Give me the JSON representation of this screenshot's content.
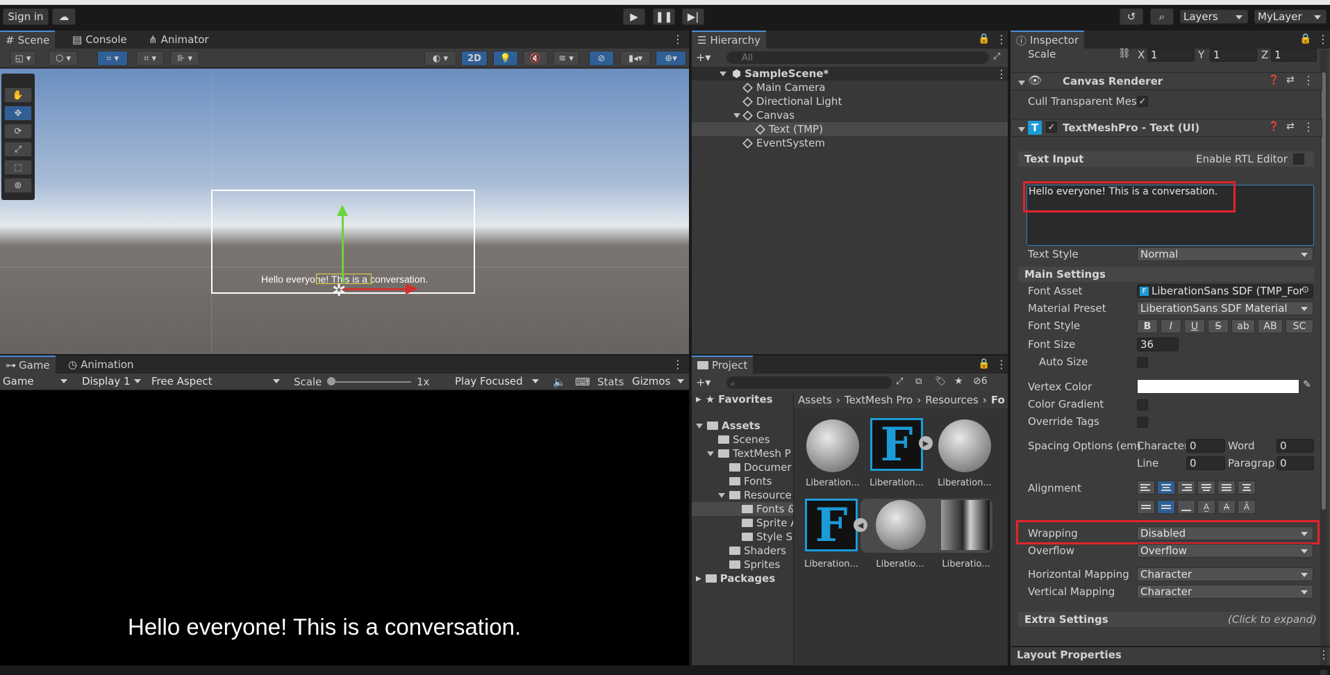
{
  "toolbar": {
    "sign_in": "Sign in",
    "layers": "Layers",
    "layout": "MyLayer"
  },
  "scene_panel": {
    "tabs": [
      "Scene",
      "Console",
      "Animator"
    ],
    "mode_2d": "2D",
    "scene_text": "Hello everyone! This is a conversation."
  },
  "game_panel": {
    "tabs": [
      "Game",
      "Animation"
    ],
    "display_mode": "Game",
    "display": "Display 1",
    "aspect": "Free Aspect",
    "scale_label": "Scale",
    "scale_value": "1x",
    "play_mode": "Play Focused",
    "stats": "Stats",
    "gizmos": "Gizmos",
    "game_text": "Hello everyone! This is a conversation."
  },
  "hierarchy": {
    "title": "Hierarchy",
    "search_placeholder": "All",
    "items": [
      "SampleScene*",
      "Main Camera",
      "Directional Light",
      "Canvas",
      "Text (TMP)",
      "EventSystem"
    ]
  },
  "project": {
    "title": "Project",
    "hidden_count": "6",
    "favorites": "Favorites",
    "assets": "Assets",
    "tree": [
      "Scenes",
      "TextMesh P",
      "Documer",
      "Fonts",
      "Resource",
      "Fonts &",
      "Sprite A",
      "Style S",
      "Shaders",
      "Sprites"
    ],
    "packages": "Packages",
    "breadcrumb": [
      "Assets",
      "TextMesh Pro",
      "Resources",
      "Fo"
    ],
    "thumbs": [
      "Liberation...",
      "Liberation...",
      "Liberation...",
      "Liberation...",
      "Liberatio...",
      "Liberatio..."
    ]
  },
  "inspector": {
    "title": "Inspector",
    "scale_label": "Scale",
    "scale_x": "1",
    "scale_y": "1",
    "scale_z": "1",
    "axis_x": "X",
    "axis_y": "Y",
    "axis_z": "Z",
    "canvas_renderer": "Canvas Renderer",
    "cull_label": "Cull Transparent Mes",
    "tmp_component": "TextMeshPro - Text (UI)",
    "text_input_label": "Text Input",
    "rtl_label": "Enable RTL Editor",
    "text_value": "Hello everyone! This is a conversation.",
    "text_style_label": "Text Style",
    "text_style": "Normal",
    "main_settings": "Main Settings",
    "font_asset_label": "Font Asset",
    "font_asset": "LiberationSans SDF (TMP_For",
    "material_label": "Material Preset",
    "material": "LiberationSans SDF Material",
    "font_style_label": "Font Style",
    "font_style_buttons": [
      "B",
      "I",
      "U",
      "S",
      "ab",
      "AB",
      "SC"
    ],
    "font_size_label": "Font Size",
    "font_size": "36",
    "auto_size_label": "Auto Size",
    "vertex_color_label": "Vertex Color",
    "color_gradient_label": "Color Gradient",
    "override_tags_label": "Override Tags",
    "spacing_label": "Spacing Options (em)",
    "character_label": "Character",
    "character_value": "0",
    "word_label": "Word",
    "word_value": "0",
    "line_label": "Line",
    "line_value": "0",
    "paragraph_label": "Paragraph",
    "paragraph_value": "0",
    "alignment_label": "Alignment",
    "wrapping_label": "Wrapping",
    "wrapping": "Disabled",
    "overflow_label": "Overflow",
    "overflow": "Overflow",
    "hmap_label": "Horizontal Mapping",
    "hmap": "Character",
    "vmap_label": "Vertical Mapping",
    "vmap": "Character",
    "extra_settings": "Extra Settings",
    "click_expand": "(Click to expand)",
    "layout_properties": "Layout Properties"
  },
  "colors": {
    "accent": "#2f5f95",
    "highlight": "#e3242b",
    "tmp_blue": "#1b9bd8"
  }
}
